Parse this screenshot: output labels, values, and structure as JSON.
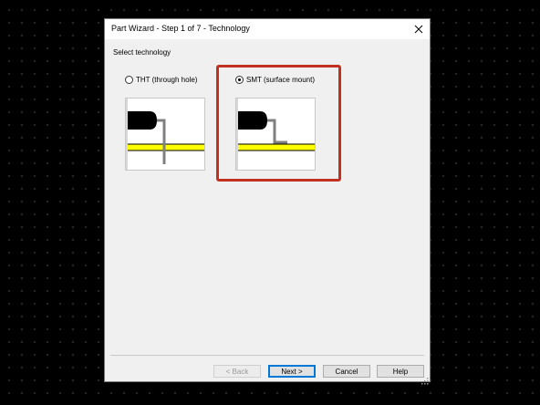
{
  "dialog": {
    "title": "Part Wizard - Step 1 of 7 - Technology",
    "section_label": "Select technology",
    "options": [
      {
        "label": "THT (through hole)",
        "selected": false
      },
      {
        "label": "SMT (surface mount)",
        "selected": true
      }
    ],
    "buttons": {
      "back": "< Back",
      "next": "Next >",
      "cancel": "Cancel",
      "help": "Help"
    }
  },
  "colors": {
    "highlight": "#c0311f",
    "trace": "#ffff00",
    "pin": "#808080"
  },
  "icons": [
    "close-icon",
    "tht-preview-image",
    "smt-preview-image",
    "resize-grip-icon"
  ]
}
